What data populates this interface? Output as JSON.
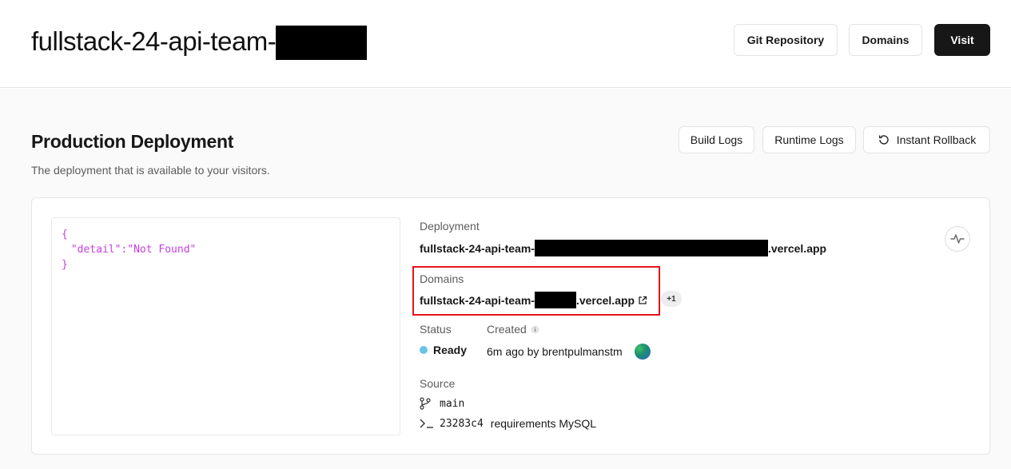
{
  "header": {
    "project_title": "fullstack-24-api-team-",
    "buttons": {
      "git_repository": "Git Repository",
      "domains": "Domains",
      "visit": "Visit"
    }
  },
  "production": {
    "title": "Production Deployment",
    "description": "The deployment that is available to your visitors.",
    "buttons": {
      "build_logs": "Build Logs",
      "runtime_logs": "Runtime Logs",
      "instant_rollback": "Instant Rollback"
    }
  },
  "preview": {
    "lines": [
      "{",
      " \"detail\":\"Not Found\"",
      "}"
    ]
  },
  "deployment": {
    "label": "Deployment",
    "url_prefix": "fullstack-24-api-team-",
    "url_suffix": ".vercel.app"
  },
  "domains": {
    "label": "Domains",
    "url_prefix": "fullstack-24-api-team-",
    "url_suffix": ".vercel.app",
    "more_badge": "+1"
  },
  "status": {
    "label": "Status",
    "value": "Ready",
    "color": "#6cc3ea"
  },
  "created": {
    "label": "Created",
    "value": "6m ago by brentpulmanstm"
  },
  "source": {
    "label": "Source",
    "branch": "main",
    "commit_hash": "23283c4",
    "commit_message": "requirements MySQL"
  },
  "colors": {
    "highlight": "#e0161c",
    "preview_text": "#c43fe0",
    "visit_button": "#171717"
  },
  "icons": [
    "rollback-icon",
    "activity-icon",
    "external-link-icon",
    "info-icon",
    "git-branch-icon",
    "terminal-icon"
  ]
}
